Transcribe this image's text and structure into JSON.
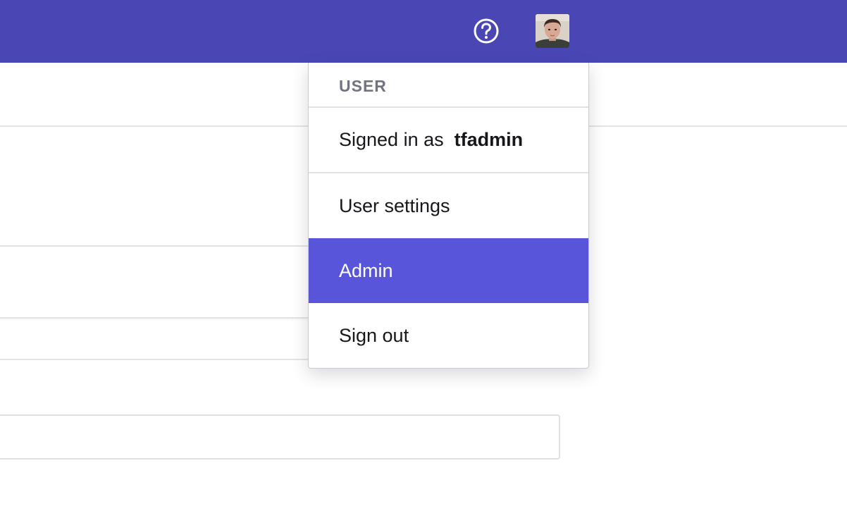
{
  "colors": {
    "topbar": "#4a47b5",
    "menu_active": "#5855db",
    "menu_header_text": "#6f7480"
  },
  "topbar": {
    "help_icon": "question-circle-icon",
    "avatar": "user-avatar-photo"
  },
  "user_menu": {
    "header": "USER",
    "signed_in_prefix": "Signed in as",
    "username": "tfadmin",
    "items": [
      {
        "label": "User settings",
        "active": false
      },
      {
        "label": "Admin",
        "active": true
      },
      {
        "label": "Sign out",
        "active": false
      }
    ]
  }
}
